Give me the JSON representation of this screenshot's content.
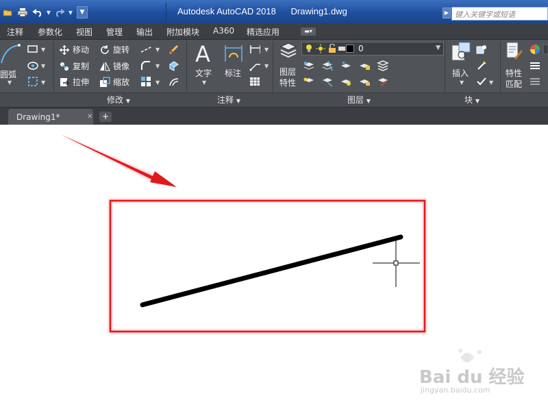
{
  "title_bar": {
    "app_title": "Autodesk AutoCAD 2018",
    "file_name": "Drawing1.dwg",
    "search_placeholder": "键入关键字或短语"
  },
  "menu_tabs": [
    {
      "label": "注释"
    },
    {
      "label": "参数化"
    },
    {
      "label": "视图"
    },
    {
      "label": "管理"
    },
    {
      "label": "输出"
    },
    {
      "label": "附加模块"
    },
    {
      "label": "A360"
    },
    {
      "label": "精选应用"
    }
  ],
  "ribbon": {
    "draw_panel": {
      "arc_label": "圆弧"
    },
    "modify_panel": {
      "items": [
        {
          "label": "移动",
          "icon": "move-icon"
        },
        {
          "label": "旋转",
          "icon": "rotate-icon"
        },
        {
          "label": "复制",
          "icon": "copy-icon"
        },
        {
          "label": "镜像",
          "icon": "mirror-icon"
        },
        {
          "label": "拉伸",
          "icon": "stretch-icon"
        },
        {
          "label": "缩放",
          "icon": "scale-icon"
        }
      ],
      "footer": "修改"
    },
    "annotation_panel": {
      "text_label": "文字",
      "dimension_label": "标注",
      "footer": "注释"
    },
    "layers_panel": {
      "properties_label_line1": "图层",
      "properties_label_line2": "特性",
      "current_layer": "0",
      "footer": "图层"
    },
    "block_panel": {
      "insert_label": "插入",
      "footer": "块"
    },
    "properties_panel": {
      "match_label_line1": "特性",
      "match_label_line2": "匹配"
    }
  },
  "doc_tabs": {
    "active_tab": "Drawing1*"
  },
  "canvas": {
    "annotation_color": "#e0191f",
    "line_color": "#000000"
  },
  "watermark": {
    "brand": "Bai du 经验",
    "url": "jingyan.baidu.com"
  }
}
